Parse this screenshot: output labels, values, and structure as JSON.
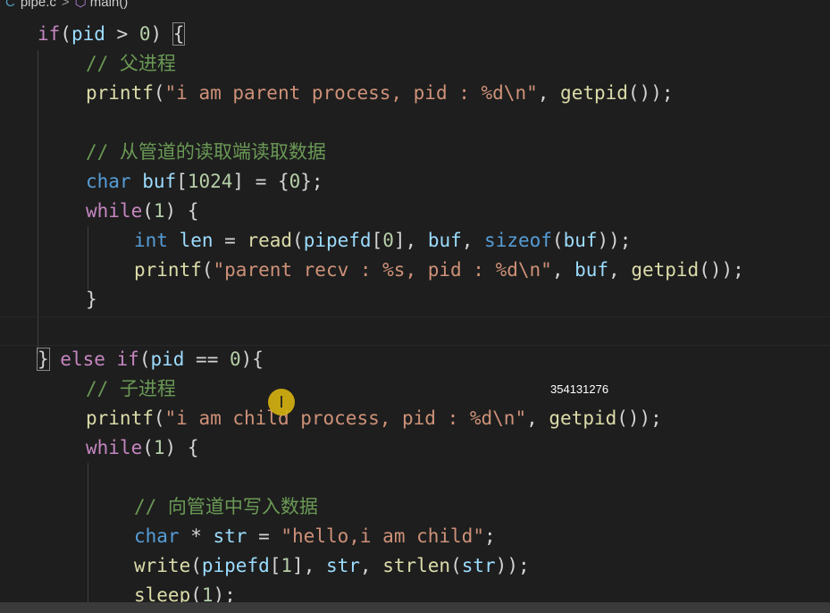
{
  "breadcrumb": {
    "file": "pipe.c",
    "separator": ">",
    "symbol": "main()"
  },
  "code": {
    "line1": {
      "if": "if",
      "p1": "(",
      "pid": "pid",
      "op": " > ",
      "zero": "0",
      "p2": ") ",
      "brace": "{"
    },
    "line2": {
      "comment": "// 父进程"
    },
    "line3": {
      "fn": "printf",
      "p1": "(",
      "str": "\"i am parent process, pid : %d\\n\"",
      "comma": ", ",
      "fn2": "getpid",
      "p2": "());"
    },
    "line5": {
      "comment": "// 从管道的读取端读取数据"
    },
    "line6": {
      "type": "char",
      "sp": " ",
      "var": "buf",
      "b1": "[",
      "num": "1024",
      "b2": "] = {",
      "zero": "0",
      "b3": "};"
    },
    "line7": {
      "kw": "while",
      "p1": "(",
      "num": "1",
      "p2": ") {"
    },
    "line8": {
      "type": "int",
      "sp": " ",
      "var": "len",
      "eq": " = ",
      "fn": "read",
      "p1": "(",
      "arg1": "pipefd",
      "b1": "[",
      "num": "0",
      "b2": "], ",
      "arg2": "buf",
      "c": ", ",
      "kw": "sizeof",
      "p2": "(",
      "arg3": "buf",
      "p3": "));"
    },
    "line9": {
      "fn": "printf",
      "p1": "(",
      "str": "\"parent recv : %s, pid : %d\\n\"",
      "c1": ", ",
      "arg": "buf",
      "c2": ", ",
      "fn2": "getpid",
      "p2": "());"
    },
    "line10": {
      "brace": "}"
    },
    "line12": {
      "brace": "}",
      "else": " else ",
      "if": "if",
      "p1": "(",
      "pid": "pid",
      "op": " == ",
      "zero": "0",
      "p2": "){"
    },
    "line13": {
      "comment": "// 子进程"
    },
    "line14": {
      "fn": "printf",
      "p1": "(",
      "str": "\"i am child process, pid : %d\\n\"",
      "comma": ", ",
      "fn2": "getpid",
      "p2": "());"
    },
    "line15": {
      "kw": "while",
      "p1": "(",
      "num": "1",
      "p2": ") {"
    },
    "line17": {
      "comment": "// 向管道中写入数据"
    },
    "line18": {
      "type": "char",
      "star": " * ",
      "var": "str",
      "eq": " = ",
      "str": "\"hello,i am child\"",
      "semi": ";"
    },
    "line19": {
      "fn": "write",
      "p1": "(",
      "arg1": "pipefd",
      "b1": "[",
      "num": "1",
      "b2": "], ",
      "arg2": "str",
      "c": ", ",
      "fn2": "strlen",
      "p2": "(",
      "arg3": "str",
      "p3": "));"
    },
    "line20": {
      "fn": "sleep",
      "p1": "(",
      "num": "1",
      "p2": ");"
    }
  },
  "overlay": {
    "watermark": "354131276",
    "cursor": "I"
  },
  "icons": {
    "file_icon": "c-file-icon",
    "symbol_icon": "cube-icon",
    "cursor_icon": "ibeam-cursor-icon"
  },
  "colors": {
    "background": "#1e1e1e",
    "keyword": "#c586c0",
    "type": "#569cd6",
    "function": "#dcdcaa",
    "variable": "#9cdcfe",
    "number": "#b5cea8",
    "string": "#ce9178",
    "comment": "#6a9955",
    "cursor_highlight": "#d6b20f"
  }
}
